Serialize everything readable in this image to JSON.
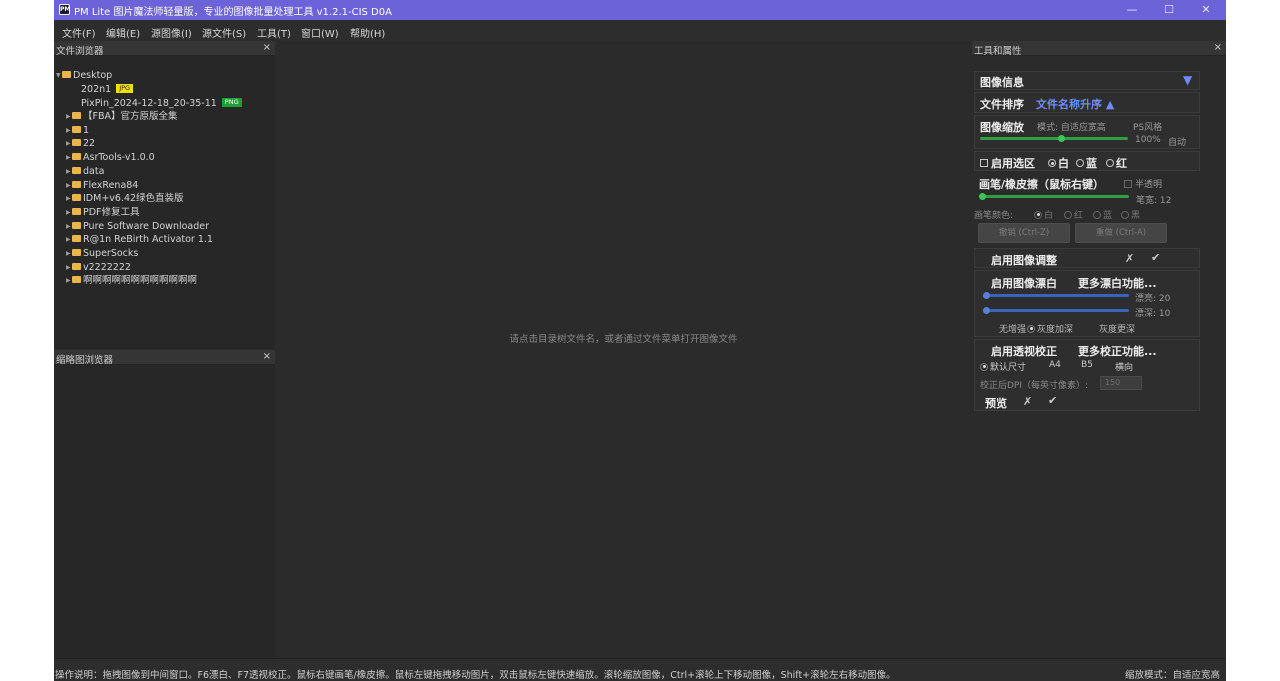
{
  "window": {
    "title": "PM Lite 图片魔法师轻量版，专业的图像批量处理工具 v1.2.1-CIS D0A",
    "app_icon_text": "PM",
    "controls": [
      "—",
      "☐",
      "✕"
    ]
  },
  "menu": [
    "文件(F)",
    "编辑(E)",
    "源图像(I)",
    "源文件(S)",
    "工具(T)",
    "窗口(W)",
    "帮助(H)"
  ],
  "file_browser": {
    "title": "文件浏览器",
    "close": "×",
    "root": "Desktop",
    "files": [
      {
        "name": "202n1",
        "badge": "JPG",
        "badge_color": "#f2e000"
      },
      {
        "name": "PixPin_2024-12-18_20-35-11",
        "badge": "PNG",
        "badge_color": "#1f9d3a"
      }
    ],
    "folders": [
      "【FBA】官方原版全集",
      "1",
      "22",
      "AsrTools-v1.0.0",
      "data",
      "FlexRena84",
      "IDM+v6.42绿色直装版",
      "PDF修复工具",
      "Pure Software Downloader",
      "R@1n ReBirth Activator 1.1",
      "SuperSocks",
      "v2222222",
      "啊啊啊啊啊啊啊啊啊啊啊啊"
    ]
  },
  "thumb_browser": {
    "title": "缩略图浏览器",
    "close": "×"
  },
  "center": {
    "hint": "请点击目录树文件名，或者通过文件菜单打开图像文件"
  },
  "tools": {
    "title": "工具和属性",
    "close": "×",
    "image_info": "图像信息",
    "image_info_arrow": "▼",
    "sort_label": "文件排序",
    "sort_value": "文件名称升序 ▲",
    "zoom": {
      "label": "图像缩放",
      "mode": "模式: 自适应宽高",
      "ps_style": "PS风格",
      "percent": "100%",
      "auto": "自动",
      "level": 0.55
    },
    "selection": {
      "label": "启用选区",
      "options": [
        "白",
        "蓝",
        "红"
      ],
      "selected": 0
    },
    "brush": {
      "label": "画笔/橡皮擦（鼠标右键）",
      "semi": "半透明",
      "size_label": "笔宽: 12",
      "level": 0.02,
      "color_label": "画笔颜色:",
      "colors": [
        "白",
        "红",
        "蓝",
        "黑"
      ],
      "undo": "撤销 (Ctrl-Z)",
      "redo": "重做 (Ctrl-A)"
    },
    "adjust": {
      "label": "启用图像调整",
      "cancel": "✗",
      "ok": "✔"
    },
    "whiten": {
      "label": "启用图像漂白",
      "more": "更多漂白功能...",
      "s1_label": "漂亮: 20",
      "s2_label": "漂深: 10",
      "s1_level": 0.02,
      "s2_level": 0.02,
      "opts": [
        "无增强",
        "灰度加深",
        "灰度更深"
      ]
    },
    "perspective": {
      "label": "启用透视校正",
      "more": "更多校正功能...",
      "sizes": [
        "默认尺寸",
        "A4",
        "B5",
        "横向"
      ],
      "dpi_label": "校正后DPI（每英寸像素）:",
      "dpi_value": "150",
      "preview": "预览",
      "cancel": "✗",
      "ok": "✔"
    }
  },
  "status": {
    "help": "操作说明：拖拽图像到中间窗口。F6漂白、F7透视校正。鼠标右键画笔/橡皮擦。鼠标左键拖拽移动图片，双击鼠标左键快速缩放。滚轮缩放图像，Ctrl+滚轮上下移动图像，Shift+滚轮左右移动图像。",
    "zoom_mode": "缩放模式：自适应宽高"
  },
  "colors": {
    "titlebar": "#6c63d8",
    "accent_blue": "#6f8cff",
    "slider_green": "#2ea043"
  }
}
